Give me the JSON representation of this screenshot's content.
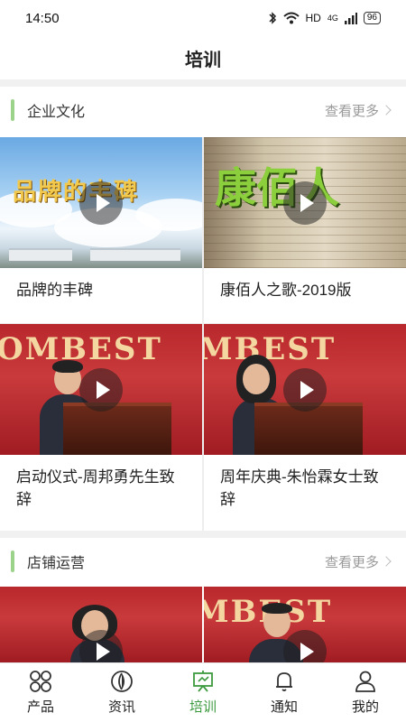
{
  "status_bar": {
    "time": "14:50",
    "network": "HD",
    "signal_label": "4G",
    "battery": "96"
  },
  "page": {
    "title": "培训"
  },
  "sections": [
    {
      "title": "企业文化",
      "more_label": "查看更多",
      "cards": [
        {
          "caption": "品牌的丰碑",
          "thumb_text": "品牌的丰碑"
        },
        {
          "caption": "康佰人之歌-2019版",
          "thumb_text": "康佰人"
        },
        {
          "caption": "启动仪式-周邦勇先生致辞",
          "thumb_text": "OMBEST"
        },
        {
          "caption": "周年庆典-朱怡霖女士致辞",
          "thumb_text": "MBEST"
        }
      ]
    },
    {
      "title": "店铺运营",
      "more_label": "查看更多",
      "cards": [
        {
          "thumb_text": ""
        },
        {
          "thumb_text": "MBEST"
        }
      ]
    }
  ],
  "bottom_nav": [
    {
      "label": "产品",
      "icon": "grid-icon"
    },
    {
      "label": "资讯",
      "icon": "compass-icon"
    },
    {
      "label": "培训",
      "icon": "easel-icon",
      "active": true
    },
    {
      "label": "通知",
      "icon": "bell-icon"
    },
    {
      "label": "我的",
      "icon": "person-icon"
    }
  ],
  "colors": {
    "accent": "#3c9a3e",
    "section_bar": "#9bd38a"
  }
}
